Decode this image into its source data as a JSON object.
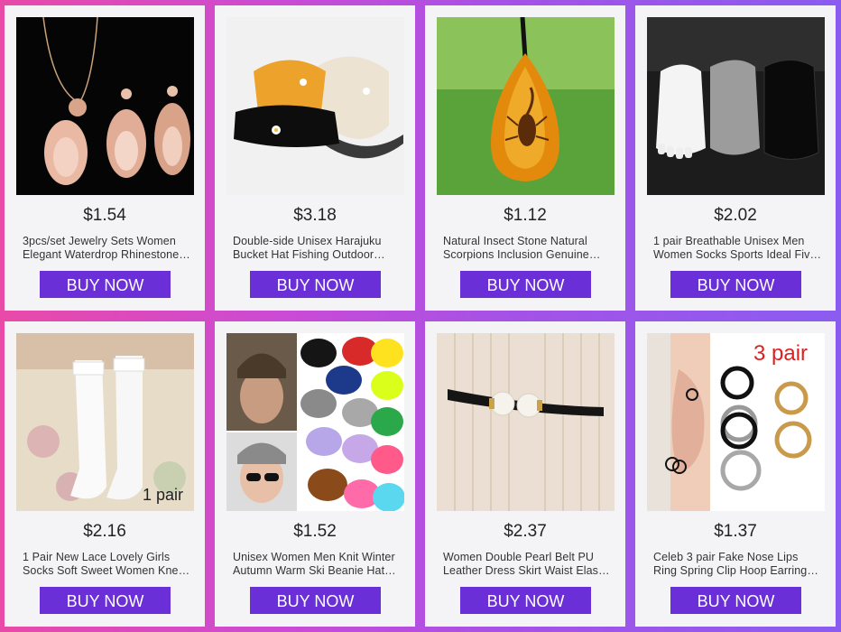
{
  "products": [
    {
      "price": "$1.54",
      "title": "3pcs/set Jewelry Sets Women Elegant Waterdrop Rhinestone Peacock Necklace Earrings",
      "button": "BUY NOW"
    },
    {
      "price": "$3.18",
      "title": "Double-side Unisex Harajuku Bucket Hat Fishing Outdoor Daisy Cap",
      "button": "BUY NOW"
    },
    {
      "price": "$1.12",
      "title": "Natural Insect Stone Natural Scorpions Inclusion Genuine Amber Pendant",
      "button": "BUY NOW"
    },
    {
      "price": "$2.02",
      "title": "1 pair Breathable Unisex Men Women Socks Sports Ideal Five Toe Socks",
      "button": "BUY NOW"
    },
    {
      "price": "$2.16",
      "title": "1 Pair New Lace Lovely Girls Socks Soft Sweet Women Knee High Socks",
      "button": "BUY NOW"
    },
    {
      "price": "$1.52",
      "title": "Unisex Women Men Knit Winter Autumn Warm Ski Beanie Hat Cap",
      "button": "BUY NOW"
    },
    {
      "price": "$2.37",
      "title": "Women Double Pearl Belt PU Leather Dress Skirt Waist Elastic Belt",
      "button": "BUY NOW"
    },
    {
      "price": "$1.37",
      "title": "Celeb 3 pair Fake Nose Lips Ring Spring Clip Hoop Earrings Set",
      "button": "BUY NOW"
    }
  ],
  "image_labels": {
    "socks_pair": "1 pair",
    "earrings_pair": "3 pair"
  }
}
